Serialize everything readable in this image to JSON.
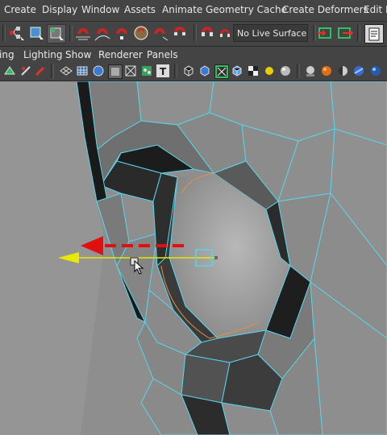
{
  "menubar": {
    "items": [
      "Create",
      "Display",
      "Window",
      "Assets",
      "Animate",
      "Geometry Cache",
      "Create Deformers",
      "Edit D"
    ]
  },
  "shelf": {
    "live_surface_label": "No Live Surface",
    "icons": [
      "select-by-hierarchy-icon",
      "select-by-object-icon",
      "select-by-component-icon",
      "snap-to-grid-icon",
      "snap-to-curve-icon",
      "snap-to-point-icon",
      "snap-to-view-plane-icon",
      "make-live-icon",
      "input-ops-icon",
      "output-ops-icon",
      "construction-history-icon"
    ]
  },
  "panel": {
    "menu_items": [
      "ing",
      "Lighting",
      "Show",
      "Renderer",
      "Panels"
    ],
    "tool_icons": [
      "select-camera-icon",
      "camera-attributes-icon",
      "bookmarks-icon",
      "grid-icon",
      "wireframe-icon",
      "smooth-shade-icon",
      "flat-shade-icon",
      "bounding-box-icon",
      "texture-icon",
      "use-lights-icon",
      "isolate-select-icon",
      "xray-icon",
      "backface-culling-icon",
      "shadows-icon",
      "ambient-occlusion-icon",
      "motion-blur-icon",
      "multisample-icon",
      "anti-alias-icon",
      "resolution-gate-icon",
      "film-gate-icon"
    ]
  },
  "viewport": {
    "wire_color": "#56d2e8",
    "manipulator_axis_color": "#e8e800",
    "arrow_annotation_color": "#e01010",
    "mesh_base_color": "#8f8f8f"
  }
}
